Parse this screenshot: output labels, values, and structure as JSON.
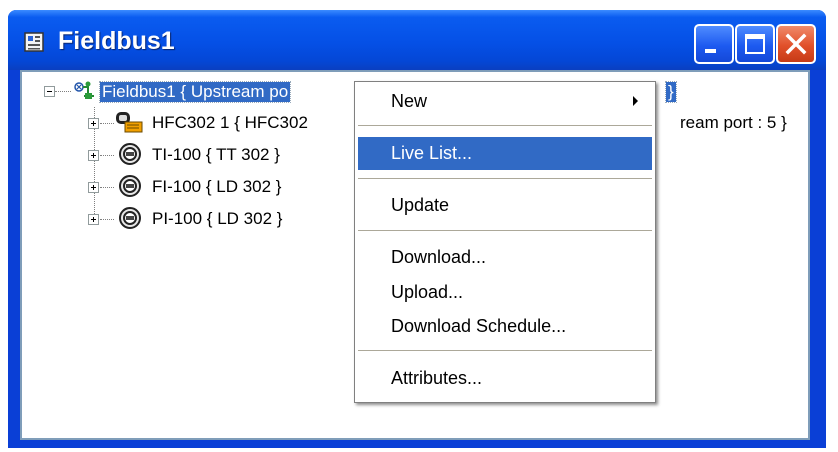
{
  "window": {
    "title": "Fieldbus1",
    "title_icon": "document-icon",
    "buttons": {
      "minimize": "minimize-icon",
      "maximize": "maximize-icon",
      "close": "close-icon"
    }
  },
  "tree": {
    "root": {
      "label": "Fieldbus1 { Upstream po",
      "label_tail": "}",
      "expanded": true
    },
    "children": [
      {
        "label": "HFC302 1 { HFC302",
        "label_tail": "ream port : 5 }",
        "icon": "hfc-device-icon"
      },
      {
        "label": "TI-100 { TT 302 }",
        "icon": "transmitter-icon"
      },
      {
        "label": "FI-100 { LD 302 }",
        "icon": "transmitter-icon"
      },
      {
        "label": "PI-100 { LD 302 }",
        "icon": "transmitter-icon"
      }
    ]
  },
  "context_menu": {
    "items": [
      {
        "label": "New",
        "submenu": true
      },
      {
        "label": "Live List...",
        "highlighted": true
      },
      {
        "label": "Update"
      },
      {
        "label": "Download..."
      },
      {
        "label": "Upload..."
      },
      {
        "label": "Download Schedule..."
      },
      {
        "label": "Attributes..."
      }
    ]
  },
  "colors": {
    "titlebar": "#0550e6",
    "selection": "#316ac5",
    "close_button": "#e1502a"
  }
}
